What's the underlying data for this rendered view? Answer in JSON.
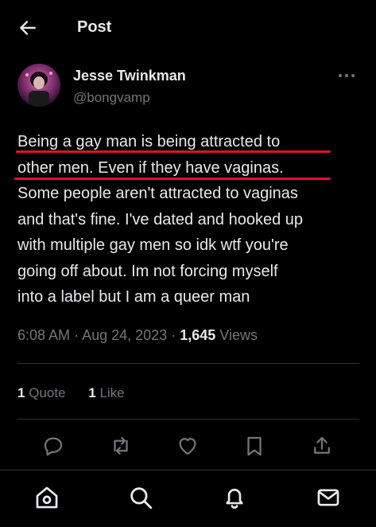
{
  "header": {
    "title": "Post",
    "back_icon": "arrow-left-icon"
  },
  "author": {
    "display_name": "Jesse Twinkman",
    "handle": "@bongvamp",
    "more_icon": "more-horizontal-icon"
  },
  "tweet": {
    "lines": [
      "Being a gay man is being attracted to",
      "other men. Even if they have vaginas.",
      "Some people aren't attracted to vaginas",
      "and that's fine. I've dated and hooked up",
      "with multiple gay men so idk wtf you're",
      "going off about. Im not forcing myself",
      "into a label but I am a queer man"
    ],
    "highlight_color": "#e0122a"
  },
  "meta": {
    "time": "6:08 AM",
    "sep1": "·",
    "date": "Aug 24, 2023",
    "sep2": "·",
    "views_count": "1,645",
    "views_label": "Views"
  },
  "stats": {
    "quote_count": "1",
    "quote_label": "Quote",
    "like_count": "1",
    "like_label": "Like"
  },
  "actions": [
    "reply-icon",
    "repost-icon",
    "like-icon",
    "bookmark-icon",
    "share-icon"
  ],
  "bottom_nav": [
    "home-icon",
    "search-icon",
    "notifications-icon",
    "messages-icon"
  ],
  "colors": {
    "background": "#000000",
    "text": "#e7e9ea",
    "secondary": "#71767b",
    "divider": "#2f3336"
  }
}
